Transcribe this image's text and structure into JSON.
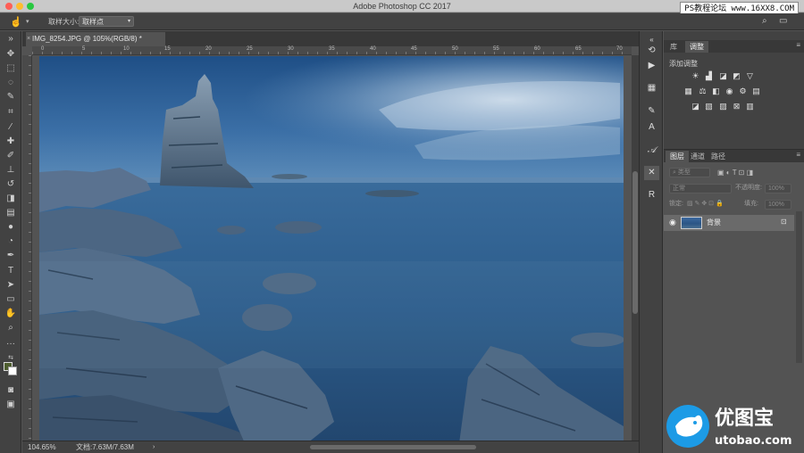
{
  "app": {
    "title": "Adobe Photoshop CC 2017",
    "watermark_top": "PS教程论坛 www.16XX8.COM"
  },
  "options_bar": {
    "sample_size_label": "取样大小:",
    "sample_size_value": "取样点"
  },
  "document": {
    "tab_title": "IMG_8254.JPG @ 105%(RGB/8) *",
    "zoom": "104.65%",
    "doc_size": "文档:7.63M/7.63M"
  },
  "ruler_numbers": [
    "0",
    "5",
    "10",
    "15",
    "20",
    "25",
    "30",
    "35",
    "40",
    "45",
    "50",
    "55",
    "60",
    "65",
    "70"
  ],
  "panels": {
    "top_tabs": [
      "库",
      "调整"
    ],
    "active_top_tab": "调整",
    "adjustments_title": "添加调整",
    "layers_tabs": [
      "图层",
      "通道",
      "路径"
    ],
    "active_layers_tab": "图层",
    "kind_filter": "类型",
    "blend_mode": "正常",
    "opacity_label": "不透明度:",
    "opacity_value": "100%",
    "lock_label": "锁定:",
    "fill_label": "填充:",
    "fill_value": "100%",
    "layer_name": "背景"
  },
  "bottom_watermark": {
    "cn": "优图宝",
    "url": "utobao.com"
  },
  "colors": {
    "foreground": "#4e5e2f",
    "background": "#ffffff",
    "ui_dark": "#424242",
    "ui_mid": "#535353"
  },
  "icons": {
    "tools": [
      "move-icon",
      "marquee-icon",
      "lasso-icon",
      "quick-select-icon",
      "crop-icon",
      "eyedropper-icon",
      "healing-icon",
      "brush-icon",
      "stamp-icon",
      "history-brush-icon",
      "eraser-icon",
      "gradient-icon",
      "blur-icon",
      "dodge-icon",
      "pen-icon",
      "type-icon",
      "path-select-icon",
      "shape-icon",
      "hand-icon",
      "zoom-icon"
    ],
    "mini_panels": [
      "history-icon",
      "play-icon",
      "swatches-icon",
      "brush-preset-icon",
      "character-icon",
      "glyph-icon",
      "tools-preset-icon",
      "paragraph-icon"
    ]
  }
}
